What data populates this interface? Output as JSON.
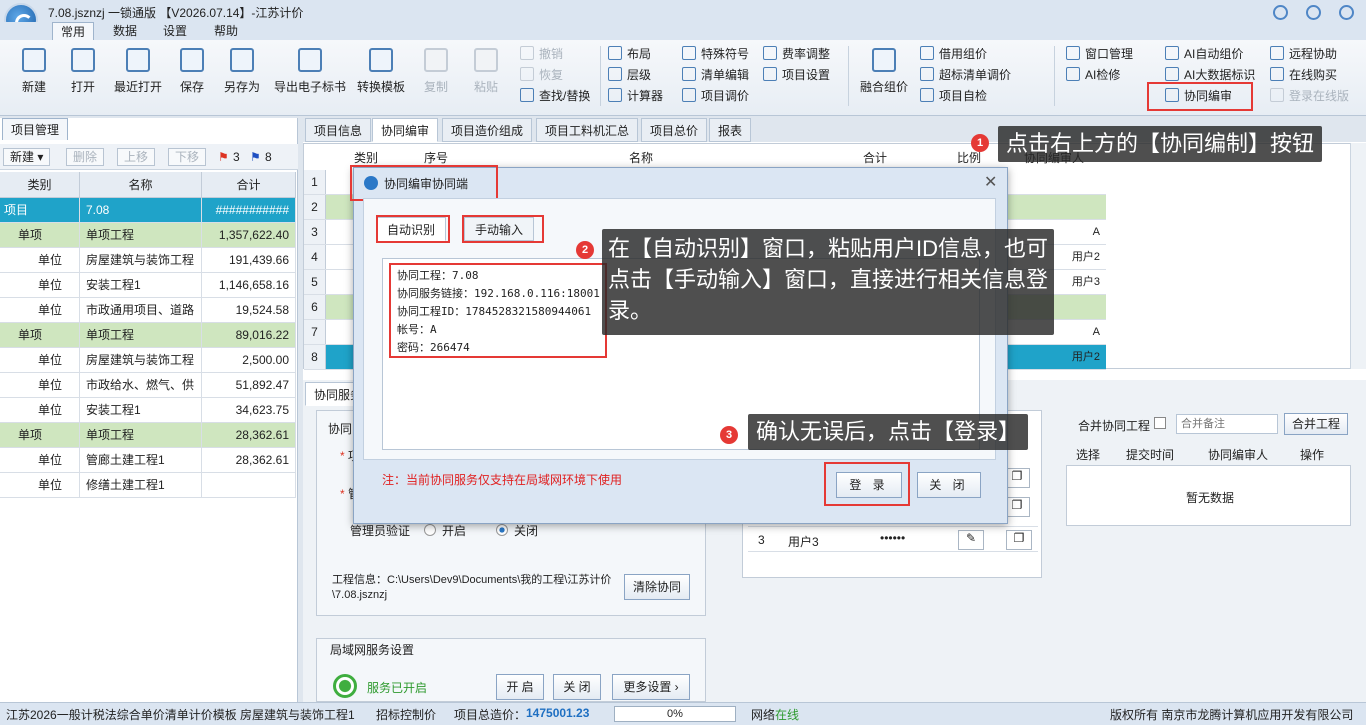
{
  "window": {
    "title": "7.08.jsznzj 一锁通版 【V2026.07.14】-江苏计价"
  },
  "menu_tabs": [
    "常用",
    "数据",
    "设置",
    "帮助"
  ],
  "ribbon": {
    "big_buttons": [
      "新建",
      "打开",
      "最近打开",
      "保存",
      "另存为",
      "导出电子标书",
      "转换模板",
      "复制",
      "粘贴"
    ],
    "edit_group": [
      "撤销",
      "恢复",
      "查找/替换"
    ],
    "layout_group": [
      "布局",
      "层级",
      "计算器"
    ],
    "symbol_group": [
      "特殊符号",
      "清单编辑",
      "项目调价"
    ],
    "fee_group": [
      "费率调整",
      "项目设置"
    ],
    "merge_button": "融合组价",
    "price_group": [
      "借用组价",
      "超标清单调价",
      "项目自检"
    ],
    "window_group": [
      "窗口管理",
      "AI检修"
    ],
    "ai_group": [
      "AI自动组价",
      "AI大数据标识",
      "协同编审"
    ],
    "remote_group": [
      "远程协助",
      "在线购买",
      "登录在线版"
    ]
  },
  "left_panel": {
    "tab": "项目管理",
    "toolbar": {
      "new": "新建",
      "delete": "删除",
      "up": "上移",
      "down": "下移",
      "red_flag_count": "3",
      "blue_flag_count": "8"
    },
    "columns": [
      "类别",
      "名称",
      "合计"
    ],
    "rows": [
      {
        "type": "项目",
        "name": "7.08",
        "total": "###########"
      },
      {
        "type": "单项",
        "name": "单项工程",
        "total": "1,357,622.40"
      },
      {
        "type": "单位",
        "name": "房屋建筑与装饰工程",
        "total": "191,439.66"
      },
      {
        "type": "单位",
        "name": "安装工程1",
        "total": "1,146,658.16"
      },
      {
        "type": "单位",
        "name": "市政通用项目、道路",
        "total": "19,524.58"
      },
      {
        "type": "单项",
        "name": "单项工程",
        "total": "89,016.22"
      },
      {
        "type": "单位",
        "name": "房屋建筑与装饰工程",
        "total": "2,500.00"
      },
      {
        "type": "单位",
        "name": "市政给水、燃气、供",
        "total": "51,892.47"
      },
      {
        "type": "单位",
        "name": "安装工程1",
        "total": "34,623.75"
      },
      {
        "type": "单项",
        "name": "单项工程",
        "total": "28,362.61"
      },
      {
        "type": "单位",
        "name": "管廊土建工程1",
        "total": "28,362.61"
      },
      {
        "type": "单位",
        "name": "修缮土建工程1",
        "total": ""
      }
    ]
  },
  "right_tabs": [
    "项目信息",
    "协同编审",
    "项目造价组成",
    "项目工料机汇总",
    "项目总价",
    "报表"
  ],
  "grid": {
    "columns": [
      "类别",
      "序号",
      "名称",
      "合计",
      "比例",
      "协同编审人"
    ],
    "row_numbers": [
      "1",
      "2",
      "3",
      "4",
      "5",
      "6",
      "7",
      "8"
    ],
    "right_values": [
      "",
      "",
      "A",
      "用户2",
      "用户3",
      "",
      "A",
      "用户2"
    ]
  },
  "lower": {
    "section_tab": "协同服务",
    "cooperate_label": "协同",
    "item_label": "项",
    "admin_label": "管",
    "admin_verify": "管理员验证",
    "radio_on": "开启",
    "radio_off": "关闭",
    "project_info_label": "工程信息：C:\\Users\\Dev9\\Documents\\我的工程\\江苏计价\\7.08.jsznzj",
    "clear_button": "清除协同",
    "lan_title": "局域网服务设置",
    "service_status": "服务已开启",
    "start_button": "开 启",
    "close_button": "关 闭",
    "more_button": "更多设置",
    "user_row": {
      "num": "3",
      "name": "用户3",
      "password": "••••••"
    },
    "merge_checkbox": "合并协同工程",
    "remark_placeholder": "合并备注",
    "merge_button": "合并工程",
    "table_headers": [
      "选择",
      "提交时间",
      "协同编审人",
      "操作"
    ],
    "empty_text": "暂无数据"
  },
  "dialog": {
    "title": "协同编审协同端",
    "tabs": [
      "自动识别",
      "手动输入"
    ],
    "content_lines": [
      "协同工程：7.08",
      "协同服务链接：192.168.0.116:18001",
      "协同工程ID：1784528321580944061",
      "帐号：A",
      "密码：266474"
    ],
    "note": "注：当前协同服务仅支持在局域网环境下使用",
    "login_button": "登 录",
    "close_button": "关 闭"
  },
  "callouts": [
    {
      "num": "1",
      "text": "点击右上方的【协同编制】按钮"
    },
    {
      "num": "2",
      "text": "在【自动识别】窗口，粘贴用户ID信息，也可点击【手动输入】窗口，直接进行相关信息登录。"
    },
    {
      "num": "3",
      "text": "确认无误后，点击【登录】"
    }
  ],
  "statusbar": {
    "template": "江苏2026一般计税法综合单价清单计价模板 房屋建筑与装饰工程1",
    "bid_control": "招标控制价",
    "total_label": "项目总造价：",
    "total_value": "1475001.23",
    "progress": "0%",
    "network_label": "网络",
    "network_status": "在线",
    "copyright": "版权所有 南京市龙腾计算机应用开发有限公司"
  },
  "colors": {
    "accent": "#1fa3c9",
    "green_row": "#cfe6bf",
    "red": "#e53935",
    "network": "#2e9a2e",
    "total_value": "#1e6fc2"
  }
}
